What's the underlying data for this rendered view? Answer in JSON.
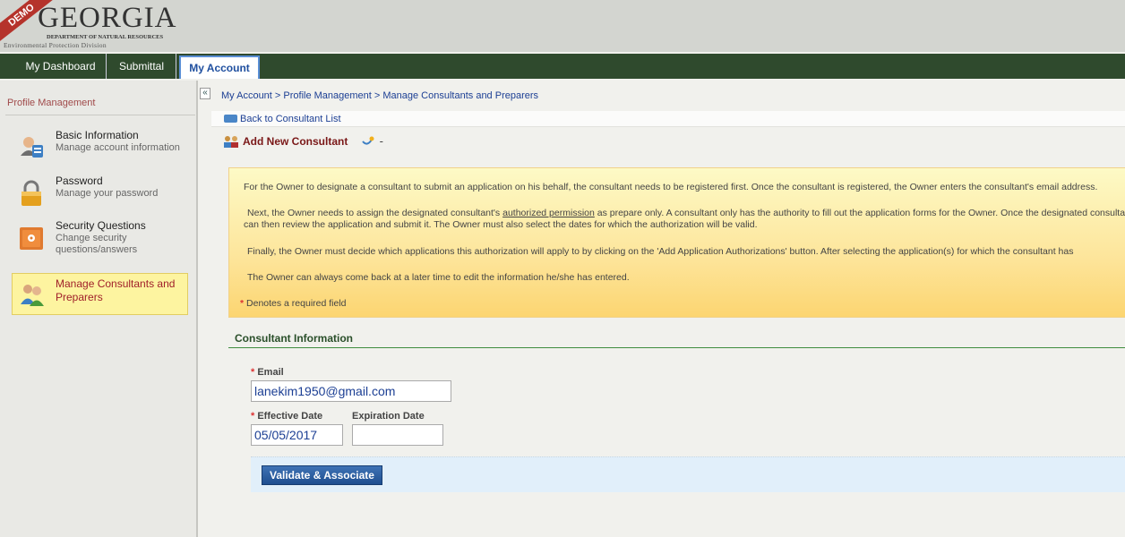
{
  "header": {
    "logo_title": "GEORGIA",
    "logo_subtitle": "DEPARTMENT OF NATURAL RESOURCES",
    "logo_division": "Environmental Protection Division",
    "demo_badge": "DEMO"
  },
  "nav": {
    "tabs": [
      {
        "label": "My Dashboard"
      },
      {
        "label": "Submittal"
      },
      {
        "label": "My Account"
      }
    ]
  },
  "sidebar": {
    "title": "Profile Management",
    "items": [
      {
        "label": "Basic Information",
        "desc": "Manage account information"
      },
      {
        "label": "Password",
        "desc": "Manage your password"
      },
      {
        "label": "Security Questions",
        "desc": "Change security questions/answers"
      },
      {
        "label": "Manage Consultants and Preparers",
        "desc": ""
      }
    ],
    "collapse_glyph": "«"
  },
  "breadcrumb": "My Account > Profile Management > Manage Consultants and Preparers",
  "back_link": "Back to Consultant List",
  "page_title": "Add New Consultant",
  "title_suffix": "-",
  "info": {
    "p1": "For the Owner to designate a consultant to submit an application on his behalf, the consultant needs to be registered first. Once the consultant is registered, the Owner enters the consultant's email address.",
    "p2_pre": "Next, the Owner needs to assign the designated consultant's ",
    "p2_link": "authorized permission",
    "p2_post": " as prepare only. A consultant only has the authority to fill out the application forms for the Owner. Once the designated consultant",
    "p2_line2": "can then review the application and submit it. The Owner must also select the dates for which the authorization will be valid.",
    "p3": "Finally, the Owner must decide which applications this authorization will apply to by clicking on the 'Add Application Authorizations' button. After selecting the application(s) for which the consultant has",
    "p4": "The Owner can always come back at a later time to edit the information he/she has entered.",
    "required_note": "Denotes a required field",
    "asterisk": "*"
  },
  "form": {
    "section_title": "Consultant Information",
    "email_label": "Email",
    "email_value": "lanekim1950@gmail.com",
    "effective_label": "Effective Date",
    "effective_value": "05/05/2017",
    "expiration_label": "Expiration Date",
    "expiration_value": "",
    "asterisk": "*"
  },
  "actions": {
    "validate_label": "Validate & Associate"
  }
}
